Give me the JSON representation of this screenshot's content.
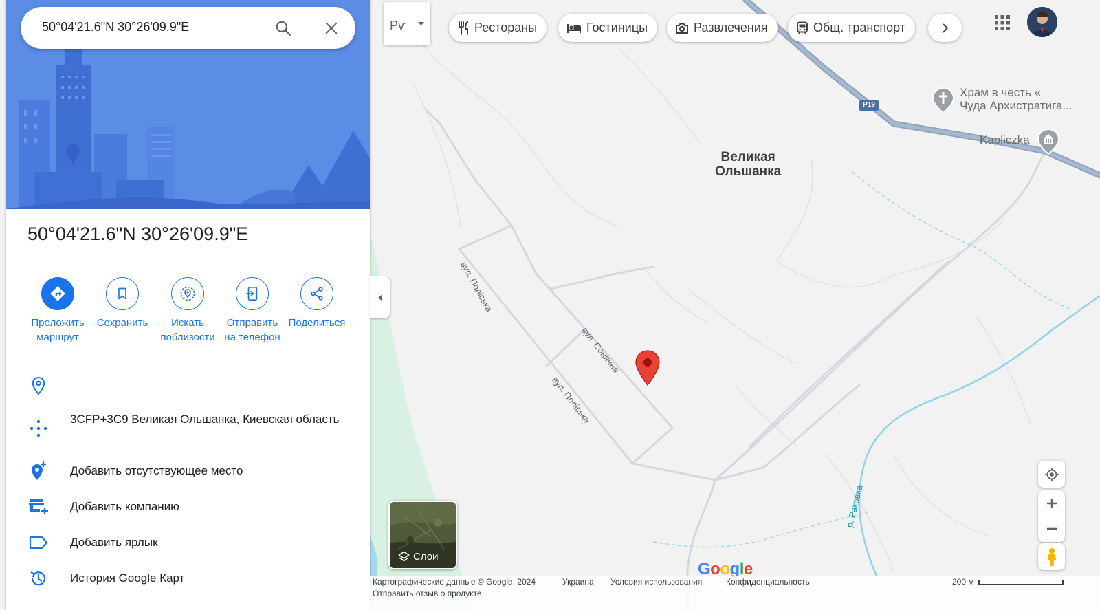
{
  "search": {
    "value": "50°04'21.6\"N 30°26'09.9\"E"
  },
  "place": {
    "title": "50°04'21.6\"N 30°26'09.9\"E"
  },
  "actions": [
    {
      "label": "Проложить маршрут",
      "icon": "directions-icon"
    },
    {
      "label": "Сохранить",
      "icon": "bookmark-icon"
    },
    {
      "label": "Искать поблизости",
      "icon": "nearby-search-icon"
    },
    {
      "label": "Отправить на телефон",
      "icon": "send-to-phone-icon"
    },
    {
      "label": "Поделиться",
      "icon": "share-icon"
    }
  ],
  "info": {
    "plus_code": "3CFP+3C9 Великая Ольшанка, Киевская область",
    "add_missing_place": "Добавить отсутствующее место",
    "add_business": "Добавить компанию",
    "add_label": "Добавить ярлык",
    "history": "История Google Карт"
  },
  "chips": {
    "restaurants": "Рестораны",
    "hotels": "Гостиницы",
    "entertainment": "Развлечения",
    "transit": "Общ. транспорт"
  },
  "transport_mode_label": "Рѵ",
  "map": {
    "town_line1": "Великая",
    "town_line2": "Ольшанка",
    "street_polisska": "вул. Поліська",
    "street_sonyachna": "вул. Сонячна",
    "river": "р. Раковка",
    "road_badge": "Р19",
    "poi_church_line1": "Храм в честь «",
    "poi_church_line2": "Чуда Архистратига...",
    "poi_chapel": "Kapliczka"
  },
  "layers_label": "Слои",
  "footer": {
    "copyright": "Картографические данные © Google, 2024",
    "country": "Украина",
    "terms": "Условия использования",
    "privacy": "Конфиденциальность",
    "feedback": "Отправить отзыв о продукте",
    "scale": "200 м"
  },
  "colors": {
    "accent": "#1a73e8",
    "pin": "#ea4335",
    "hero": "#4a7fe0",
    "water": "#8fd3e8",
    "park": "#d6f0df"
  }
}
